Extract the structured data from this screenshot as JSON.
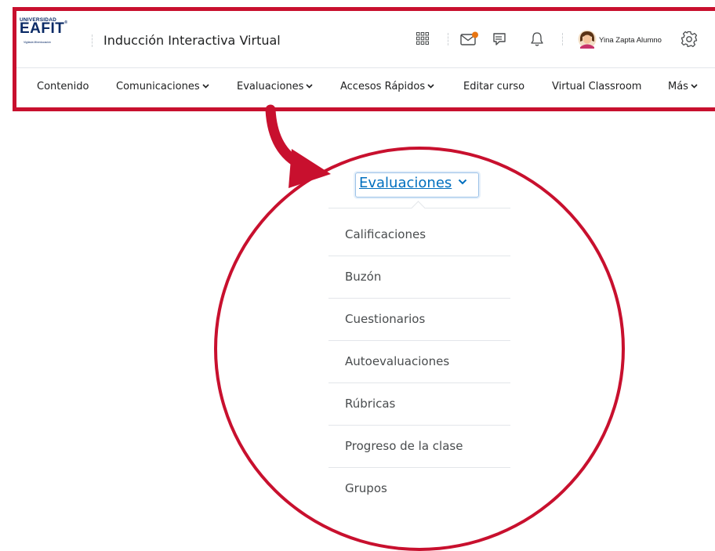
{
  "header": {
    "logo": {
      "line1": "UNIVERSIDAD",
      "line2": "EAFIT",
      "mark": "®",
      "line3": "Vigilada Mineducación"
    },
    "course_title": "Inducción Interactiva Virtual",
    "icons": [
      "waffle-icon",
      "mail-icon",
      "chat-icon",
      "bell-icon",
      "avatar",
      "gear-icon"
    ],
    "user_name": "Yina Zapta Alumno",
    "notification_color": "#e87511"
  },
  "nav": {
    "items": [
      {
        "label": "Contenido",
        "has_dropdown": false
      },
      {
        "label": "Comunicaciones",
        "has_dropdown": true
      },
      {
        "label": "Evaluaciones",
        "has_dropdown": true
      },
      {
        "label": "Accesos Rápidos",
        "has_dropdown": true
      },
      {
        "label": "Editar curso",
        "has_dropdown": false
      },
      {
        "label": "Virtual Classroom",
        "has_dropdown": false
      },
      {
        "label": "Más",
        "has_dropdown": true
      }
    ]
  },
  "dropdown": {
    "trigger_label": "Evaluaciones",
    "items": [
      "Calificaciones",
      "Buzón",
      "Cuestionarios",
      "Autoevaluaciones",
      "Rúbricas",
      "Progreso de la clase",
      "Grupos"
    ]
  },
  "colors": {
    "highlight": "#c8102e",
    "link": "#006fbf",
    "brand": "#0a2a66"
  }
}
